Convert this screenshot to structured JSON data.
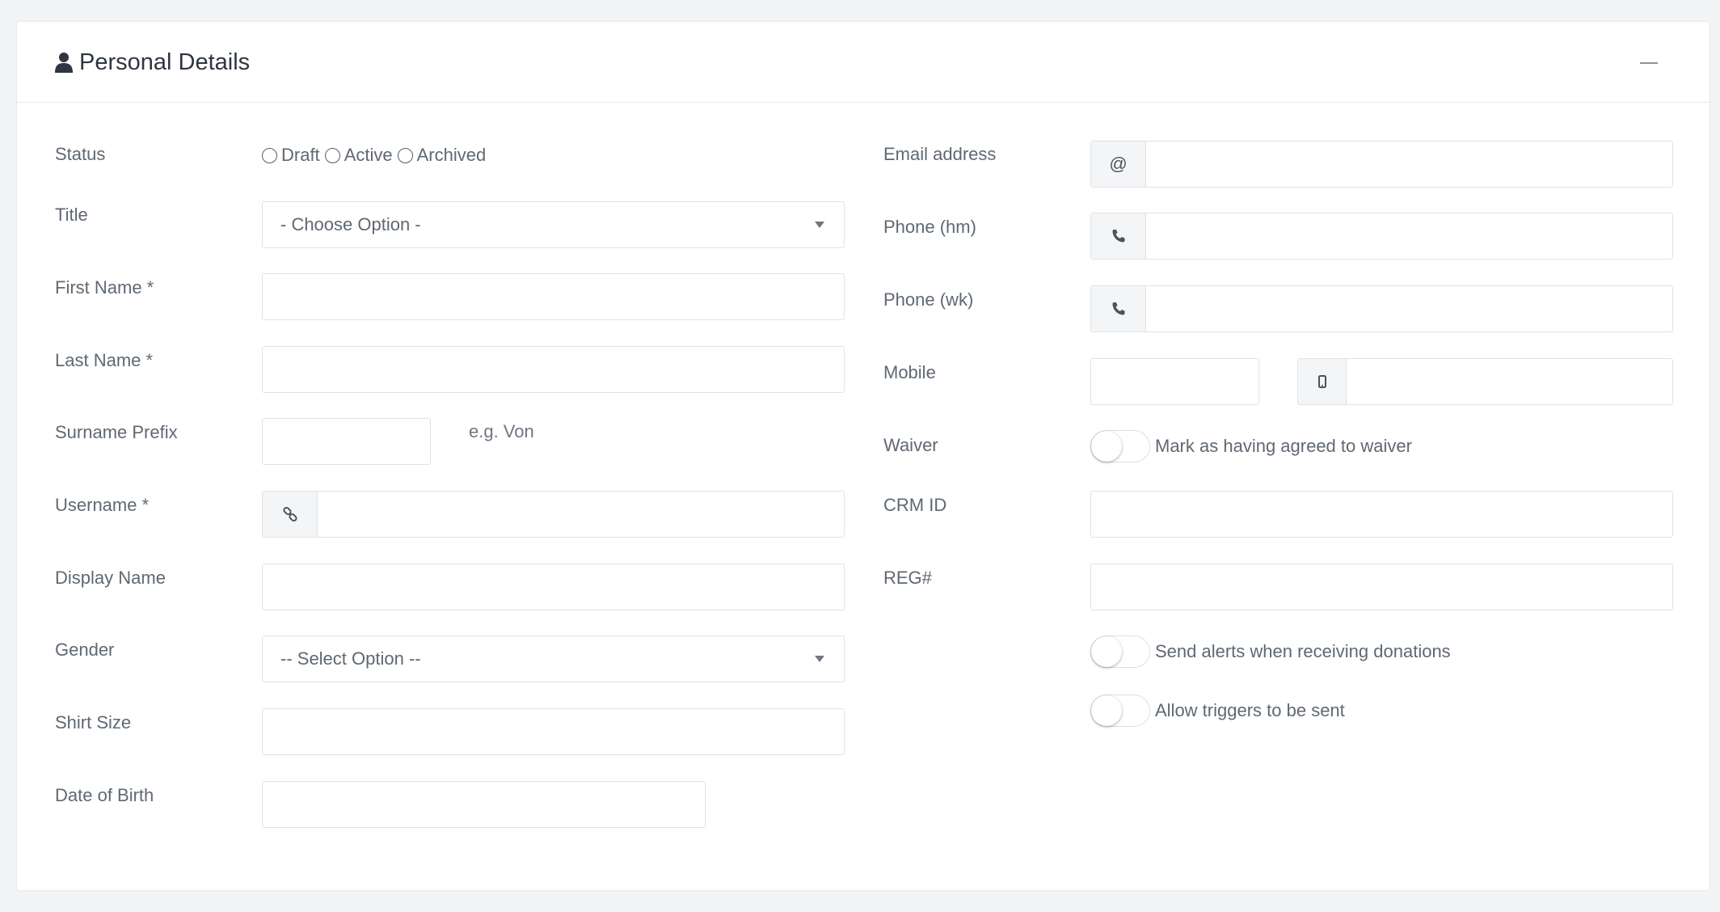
{
  "panel": {
    "title": "Personal Details",
    "icon": "user-icon"
  },
  "left": {
    "status": {
      "label": "Status",
      "options": [
        "Draft",
        "Active",
        "Archived"
      ]
    },
    "title": {
      "label": "Title",
      "value": "- Choose Option -"
    },
    "first_name": {
      "label": "First Name *",
      "value": ""
    },
    "last_name": {
      "label": "Last Name *",
      "value": ""
    },
    "surname_prefix": {
      "label": "Surname Prefix",
      "value": "",
      "hint": "e.g. Von"
    },
    "username": {
      "label": "Username *",
      "value": "",
      "icon": "link-icon"
    },
    "display_name": {
      "label": "Display Name",
      "value": ""
    },
    "gender": {
      "label": "Gender",
      "value": "-- Select Option --"
    },
    "shirt_size": {
      "label": "Shirt Size",
      "value": ""
    },
    "dob": {
      "label": "Date of Birth",
      "value": ""
    }
  },
  "right": {
    "email": {
      "label": "Email address",
      "addon": "@",
      "value": ""
    },
    "phone_hm": {
      "label": "Phone (hm)",
      "value": "",
      "icon": "phone-icon"
    },
    "phone_wk": {
      "label": "Phone (wk)",
      "value": "",
      "icon": "phone-icon"
    },
    "mobile": {
      "label": "Mobile",
      "code": "",
      "value": "",
      "icon": "mobile-icon"
    },
    "waiver": {
      "label": "Waiver",
      "toggle_label": "Mark as having agreed to waiver"
    },
    "crm_id": {
      "label": "CRM ID",
      "value": ""
    },
    "reg": {
      "label": "REG#",
      "value": ""
    },
    "alerts": {
      "toggle_label": "Send alerts when receiving donations"
    },
    "triggers": {
      "toggle_label": "Allow triggers to be sent"
    }
  }
}
